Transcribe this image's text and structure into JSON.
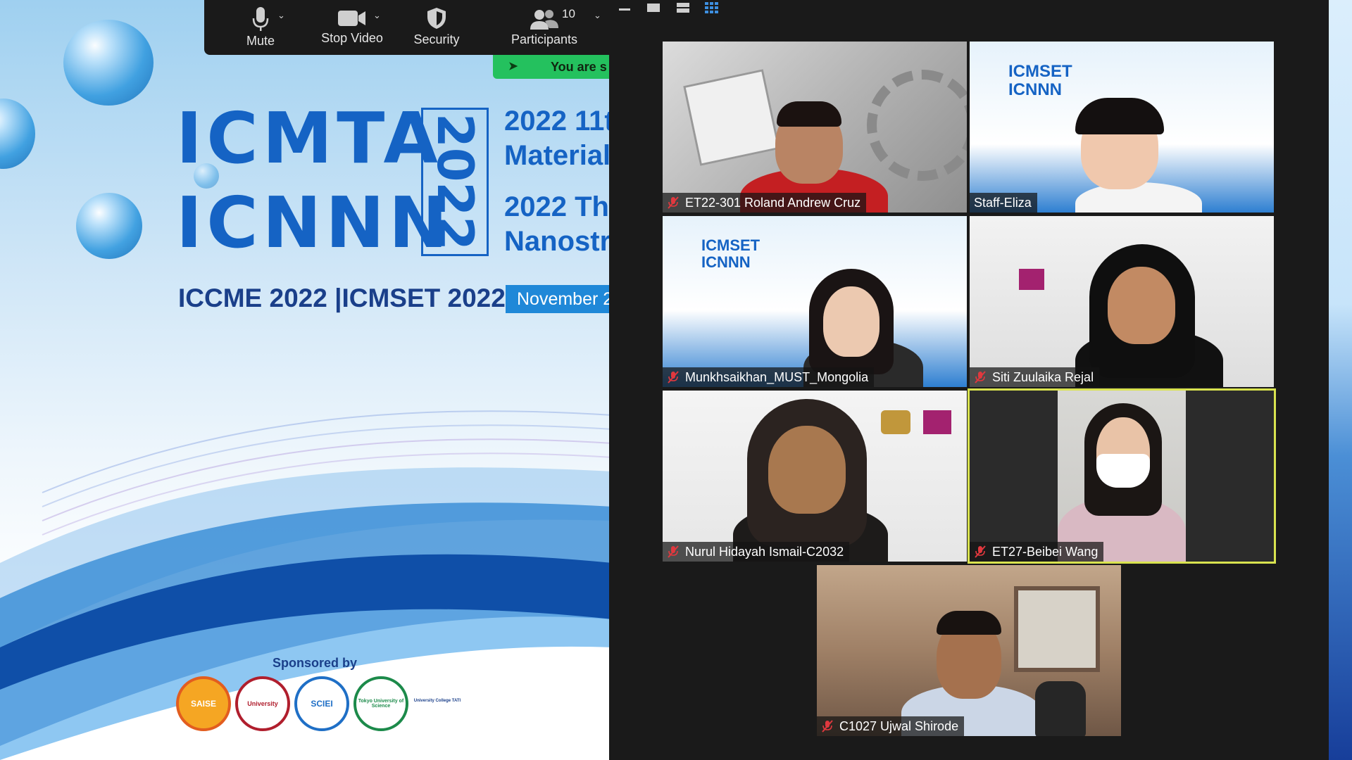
{
  "toolbar": {
    "mute_label": "Mute",
    "stop_video_label": "Stop Video",
    "security_label": "Security",
    "participants_label": "Participants",
    "participants_count": "10",
    "share_banner": "You are s"
  },
  "slide": {
    "title_line1": "ICMTA",
    "title_line2": "ICNNN",
    "year": "2022",
    "conf1_line1": "2022 11t",
    "conf1_line2": "Material",
    "conf2_line1": "2022 Th",
    "conf2_line2": "Nanostr",
    "subtitle": "ICCME 2022 |ICMSET 2022",
    "date_text": "November 2",
    "sponsored_by": "Sponsored by",
    "sponsors": [
      "SAISE",
      "University",
      "SCIEI",
      "Tokyo University of Science",
      "University College TATI"
    ]
  },
  "participants": [
    {
      "name": "ET22-301 Roland Andrew Cruz",
      "muted": true,
      "active": false
    },
    {
      "name": "Staff-Eliza",
      "muted": false,
      "active": false
    },
    {
      "name": "Munkhsaikhan_MUST_Mongolia",
      "muted": true,
      "active": false
    },
    {
      "name": "Siti Zuulaika Rejal",
      "muted": true,
      "active": false
    },
    {
      "name": "Nurul Hidayah Ismail-C2032",
      "muted": true,
      "active": false
    },
    {
      "name": "ET27-Beibei Wang",
      "muted": true,
      "active": true
    },
    {
      "name": "C1027 Ujwal Shirode",
      "muted": true,
      "active": false
    }
  ],
  "colors": {
    "toolbar_bg": "#1a1a1a",
    "share_green": "#24c15e",
    "active_speaker": "#d9e34f",
    "slide_blue": "#1563c4"
  }
}
